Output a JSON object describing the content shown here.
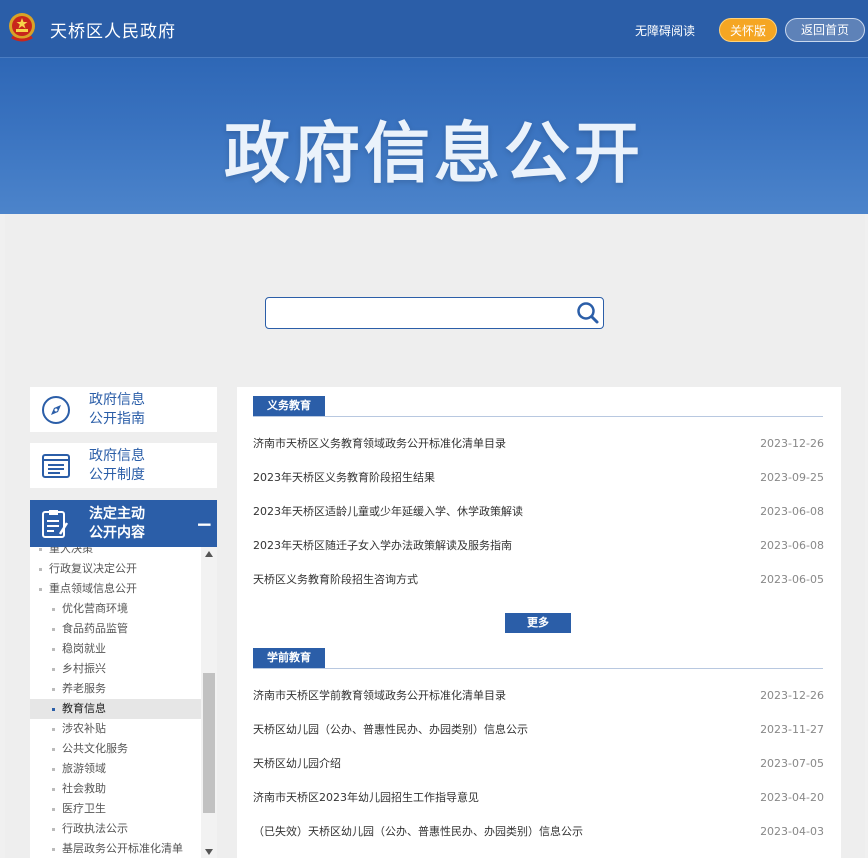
{
  "header": {
    "site_title": "天桥区人民政府",
    "accessible_label": "无障碍阅读",
    "care_label": "关怀版",
    "home_label": "返回首页",
    "accent_color": "#2b5ea8",
    "care_color": "#f5a623"
  },
  "banner": {
    "title": "政府信息公开"
  },
  "search": {
    "value": "",
    "placeholder": "",
    "icon": "search-icon"
  },
  "menu": {
    "guide": {
      "line1": "政府信息",
      "line2": "公开指南",
      "icon": "compass-icon"
    },
    "system": {
      "line1": "政府信息",
      "line2": "公开制度",
      "icon": "list-icon"
    },
    "active": {
      "line1": "法定主动",
      "line2": "公开内容",
      "icon": "document-edit-icon",
      "toggle": "−"
    }
  },
  "subnav": {
    "items": [
      {
        "label": "重大决策",
        "level": 1
      },
      {
        "label": "行政复议决定公开",
        "level": 1
      },
      {
        "label": "重点领域信息公开",
        "level": 1
      },
      {
        "label": "优化营商环境",
        "level": 2
      },
      {
        "label": "食品药品监管",
        "level": 2
      },
      {
        "label": "稳岗就业",
        "level": 2
      },
      {
        "label": "乡村振兴",
        "level": 2
      },
      {
        "label": "养老服务",
        "level": 2
      },
      {
        "label": "教育信息",
        "level": 2,
        "active": true
      },
      {
        "label": "涉农补贴",
        "level": 2
      },
      {
        "label": "公共文化服务",
        "level": 2
      },
      {
        "label": "旅游领域",
        "level": 2
      },
      {
        "label": "社会救助",
        "level": 2
      },
      {
        "label": "医疗卫生",
        "level": 2
      },
      {
        "label": "行政执法公示",
        "level": 2
      },
      {
        "label": "基层政务公开标准化清单",
        "level": 2
      }
    ]
  },
  "sections": [
    {
      "title": "义务教育",
      "more_label": "更多",
      "rows": [
        {
          "title": "济南市天桥区义务教育领域政务公开标准化清单目录",
          "date": "2023-12-26"
        },
        {
          "title": "2023年天桥区义务教育阶段招生结果",
          "date": "2023-09-25"
        },
        {
          "title": "2023年天桥区适龄儿童或少年延缓入学、休学政策解读",
          "date": "2023-06-08"
        },
        {
          "title": "2023年天桥区随迁子女入学办法政策解读及服务指南",
          "date": "2023-06-08"
        },
        {
          "title": "天桥区义务教育阶段招生咨询方式",
          "date": "2023-06-05"
        }
      ]
    },
    {
      "title": "学前教育",
      "rows": [
        {
          "title": "济南市天桥区学前教育领域政务公开标准化清单目录",
          "date": "2023-12-26"
        },
        {
          "title": "天桥区幼儿园（公办、普惠性民办、办园类别）信息公示",
          "date": "2023-11-27"
        },
        {
          "title": "天桥区幼儿园介绍",
          "date": "2023-07-05"
        },
        {
          "title": "济南市天桥区2023年幼儿园招生工作指导意见",
          "date": "2023-04-20"
        },
        {
          "title": "（已失效）天桥区幼儿园（公办、普惠性民办、办园类别）信息公示",
          "date": "2023-04-03"
        }
      ]
    }
  ]
}
